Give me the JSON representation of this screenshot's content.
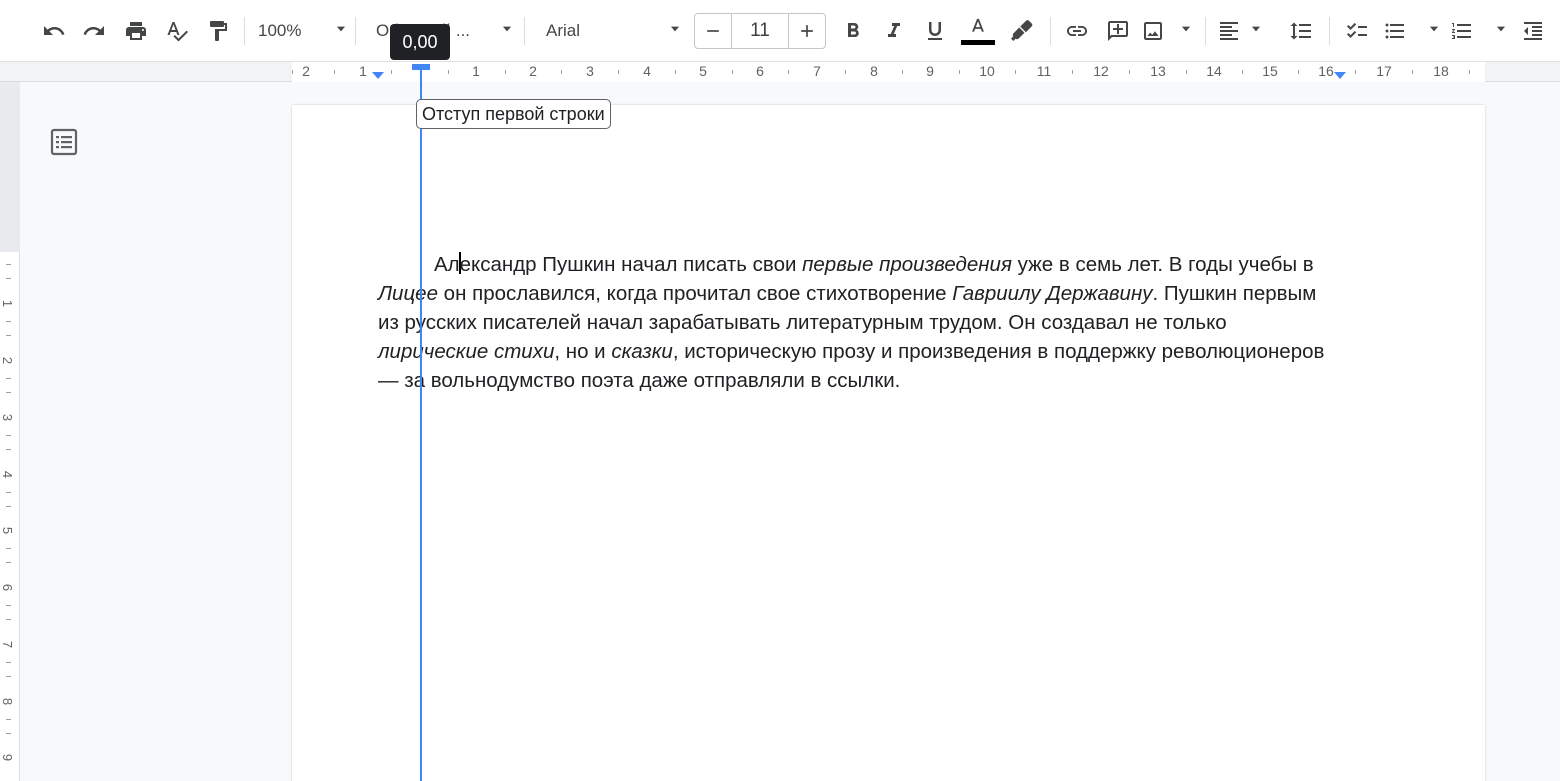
{
  "toolbar": {
    "zoom": "100%",
    "style": "Обычный ...",
    "font": "Arial",
    "font_size": "11"
  },
  "ruler": {
    "numbers": [
      "2",
      "1",
      "1",
      "2",
      "3",
      "4",
      "5",
      "6",
      "7",
      "8",
      "9",
      "10",
      "11",
      "12",
      "13",
      "14",
      "15",
      "16",
      "17",
      "18"
    ]
  },
  "vertical_ruler": {
    "numbers": [
      "1",
      "2",
      "3",
      "4",
      "5",
      "6",
      "7",
      "8",
      "9"
    ]
  },
  "indent_drag": {
    "value": "0,00",
    "tooltip": "Отступ первой строки"
  },
  "document": {
    "paragraph": [
      {
        "text": "Ал",
        "style": "normal"
      },
      {
        "text": "|cursor|",
        "style": "cursor"
      },
      {
        "text": "ександр Пушкин начал писать свои ",
        "style": "normal"
      },
      {
        "text": "первые произведения",
        "style": "italic"
      },
      {
        "text": " уже в семь лет. В годы учебы в ",
        "style": "normal"
      },
      {
        "text": "Лицее",
        "style": "italic"
      },
      {
        "text": " он прославился, когда прочитал свое стихотворение ",
        "style": "normal"
      },
      {
        "text": "Гавриилу Державину",
        "style": "italic"
      },
      {
        "text": ". Пушкин первым из русских писателей начал зарабатывать литературным трудом. Он создавал не только ",
        "style": "normal"
      },
      {
        "text": "лирические стихи",
        "style": "italic"
      },
      {
        "text": ", но и ",
        "style": "normal"
      },
      {
        "text": "сказки",
        "style": "italic"
      },
      {
        "text": ", историческую прозу и произведения в поддержку революционеров — за вольнодумство поэта даже отправляли в ссылки.",
        "style": "normal"
      }
    ]
  },
  "colors": {
    "accent": "#4285f4",
    "text_color_bar": "#000000"
  }
}
